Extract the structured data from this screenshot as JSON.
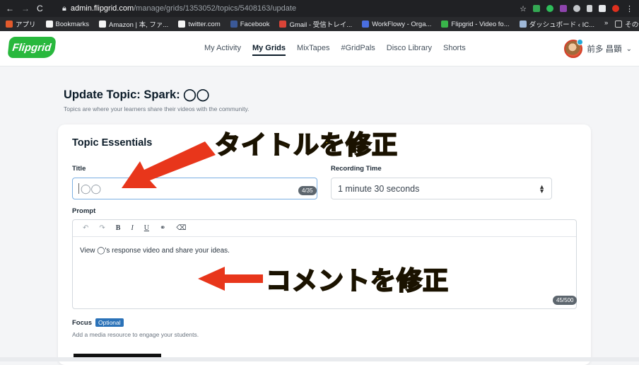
{
  "browser": {
    "url_host": "admin.flipgrid.com",
    "url_path": "/manage/grids/1353052/topics/5408163/update",
    "bookmarks": [
      {
        "label": "アプリ",
        "icon": "apps-grid-icon",
        "color": "#e25a2c"
      },
      {
        "label": "Bookmarks",
        "icon": "star-icon",
        "color": "#f5f5f5"
      },
      {
        "label": "Amazon | 本, ファ...",
        "icon": "amazon-icon",
        "color": "#f5f5f5"
      },
      {
        "label": "twitter.com",
        "icon": "globe-icon",
        "color": "#f5f5f5"
      },
      {
        "label": "Facebook",
        "icon": "facebook-icon",
        "color": "#3b5998"
      },
      {
        "label": "Gmail - 受信トレイ...",
        "icon": "gmail-icon",
        "color": "#db4437"
      },
      {
        "label": "WorkFlowy - Orga...",
        "icon": "workflowy-icon",
        "color": "#4a6ee0"
      },
      {
        "label": "Flipgrid - Video fo...",
        "icon": "flipgrid-icon",
        "color": "#39b54a"
      },
      {
        "label": "ダッシュボード ‹ IC...",
        "icon": "dashboard-icon",
        "color": "#9fb8d8"
      }
    ],
    "bookmarks_overflow": "»",
    "other_bookmarks": "その他のブックマーク"
  },
  "app": {
    "logo": "Flipgrid",
    "nav": [
      "My Activity",
      "My Grids",
      "MixTapes",
      "#GridPals",
      "Disco Library",
      "Shorts"
    ],
    "active_nav": "My Grids",
    "user_name": "前多 昌顕"
  },
  "page": {
    "title": "Update Topic: Spark: ◯◯",
    "subtitle": "Topics are where your learners share their videos with the community."
  },
  "form": {
    "section_title": "Topic Essentials",
    "title_label": "Title",
    "title_value": "◯◯",
    "title_count": "4/35",
    "recording_label": "Recording Time",
    "recording_value": "1 minute 30 seconds",
    "prompt_label": "Prompt",
    "prompt_text": "View ◯'s response video and share your ideas.",
    "prompt_count": "45/500",
    "focus_label": "Focus",
    "focus_badge": "Optional",
    "focus_sub": "Add a media resource to engage your students."
  },
  "annotations": {
    "title_note": "タイトルを修正",
    "prompt_note": "コメントを修正",
    "arrow_color": "#e8361b",
    "text_color": "#ffd400"
  }
}
